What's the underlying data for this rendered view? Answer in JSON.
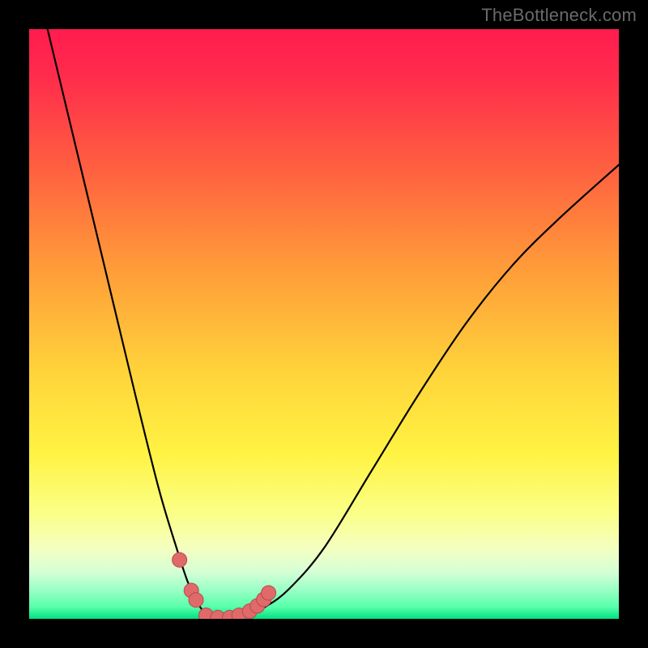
{
  "watermark": "TheBottleneck.com",
  "colors": {
    "bg_black": "#000000",
    "grad_top": "#ff1c4e",
    "grad_upper_mid": "#ff7a3a",
    "grad_mid": "#ffe943",
    "grad_lower_mid": "#f4ffae",
    "grad_green1": "#b8ffc2",
    "grad_green2": "#52ff9f",
    "grad_bottom": "#00e07f",
    "curve": "#000000",
    "dot_fill": "#e06a6a",
    "dot_stroke": "#b84a4a"
  },
  "chart_data": {
    "type": "line",
    "title": "",
    "xlabel": "",
    "ylabel": "",
    "xlim": [
      0,
      100
    ],
    "ylim": [
      0,
      100
    ],
    "series": [
      {
        "name": "bottleneck-curve",
        "x": [
          0,
          6,
          12,
          18,
          22,
          25,
          27,
          29,
          30.5,
          32,
          34,
          37,
          40,
          44,
          50,
          58,
          66,
          74,
          82,
          90,
          100
        ],
        "y": [
          113,
          88,
          63,
          38,
          22,
          12,
          6,
          2,
          0.5,
          0,
          0,
          0.5,
          2,
          5,
          12,
          25,
          38,
          50,
          60,
          68,
          77
        ]
      }
    ],
    "dots": {
      "name": "highlighted-points",
      "x": [
        25.5,
        27.5,
        28.3,
        30,
        32,
        34,
        35.6,
        37.4,
        38.7,
        39.8,
        40.6
      ],
      "y": [
        10,
        4.8,
        3.2,
        0.6,
        0.2,
        0.2,
        0.6,
        1.3,
        2.2,
        3.3,
        4.4
      ]
    },
    "annotations": [
      {
        "text": "TheBottleneck.com",
        "pos": "top-right"
      }
    ]
  }
}
